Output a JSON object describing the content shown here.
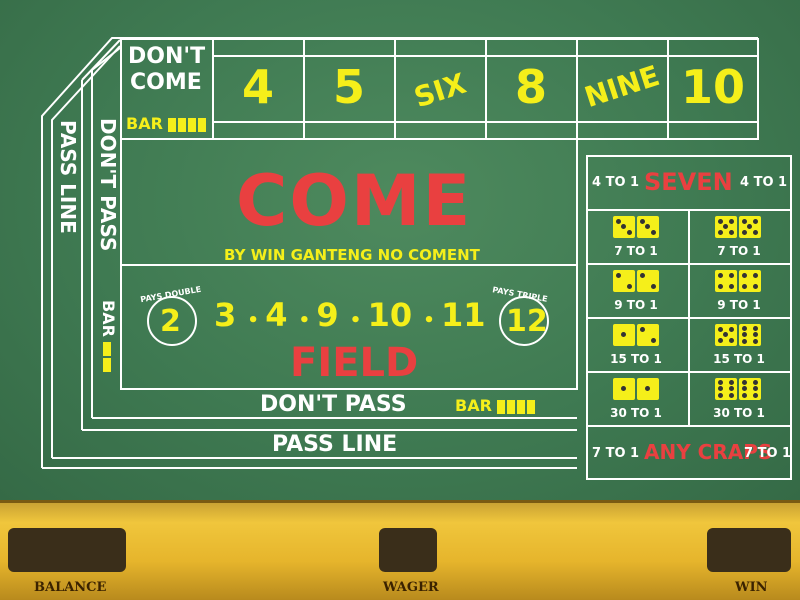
{
  "layout_table": {
    "dont_come_l1": "DON'T",
    "dont_come_l2": "COME",
    "bar": "BAR",
    "numbers": [
      "4",
      "5",
      "SIX",
      "8",
      "NINE",
      "10"
    ],
    "pass_line_vertical": "PASS LINE",
    "dont_pass_vertical": "DON'T PASS",
    "come": "COME",
    "credit": "BY WIN GANTENG NO COMENT",
    "field_left_label": "PAYS DOUBLE",
    "field_left_num": "2",
    "field_numbers": [
      "3",
      "4",
      "9",
      "10",
      "11"
    ],
    "field_right_label": "PAYS TRIPLE",
    "field_right_num": "12",
    "field": "FIELD",
    "dont_pass_bottom": "DON'T PASS",
    "pass_line_bottom": "PASS LINE"
  },
  "proposition": {
    "seven_left": "4 TO 1",
    "seven": "SEVEN",
    "seven_right": "4 TO 1",
    "hardways": [
      {
        "odds": "7 TO 1"
      },
      {
        "odds": "7 TO 1"
      },
      {
        "odds": "9 TO 1"
      },
      {
        "odds": "9 TO 1"
      },
      {
        "odds": "15 TO 1"
      },
      {
        "odds": "15 TO 1"
      },
      {
        "odds": "30 TO 1"
      },
      {
        "odds": "30 TO 1"
      }
    ],
    "any_craps_left": "7 TO 1",
    "any_craps": "ANY CRAPS",
    "any_craps_right": "7 TO 1"
  },
  "bottom_bar": {
    "balance_label": "BALANCE",
    "wager_label": "WAGER",
    "win_label": "WIN"
  },
  "colors": {
    "felt": "#3f7a52",
    "yellow": "#f5ef1a",
    "red": "#e94040",
    "tray": "#e6b52c"
  }
}
